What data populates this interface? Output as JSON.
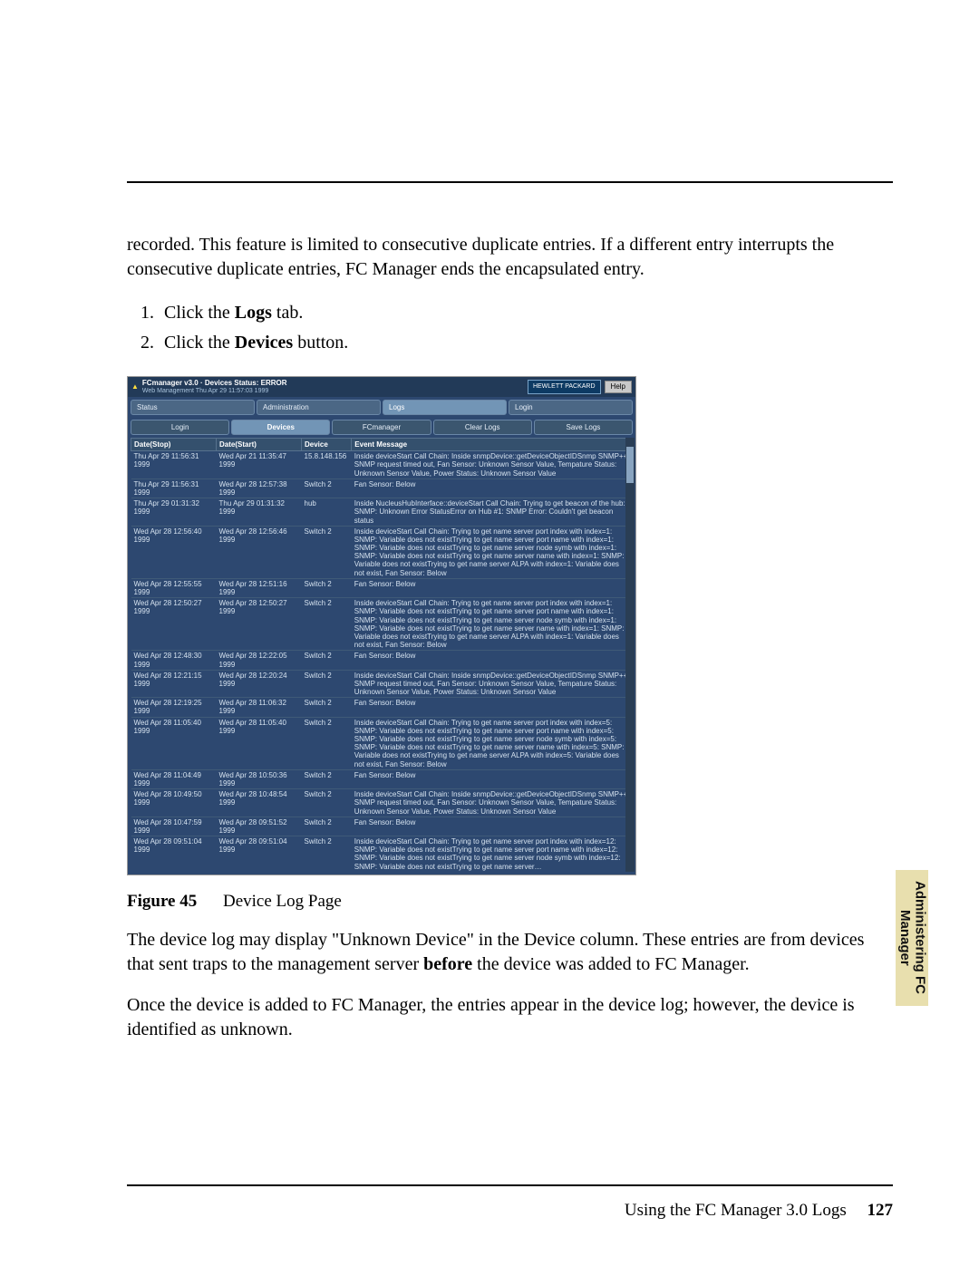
{
  "paragraphs": {
    "intro": "recorded. This feature is limited to consecutive duplicate entries. If a different entry interrupts the consecutive duplicate entries, FC Manager ends the encapsulated entry.",
    "after_fig_1a": "The device log may display \"Unknown Device\" in the Device column. These entries are from devices that sent traps to the management server ",
    "after_fig_1_bold": "before",
    "after_fig_1b": " the device was added to FC Manager.",
    "after_fig_2": "Once the device is added to FC Manager, the entries appear in the device log; however, the device is identified as unknown."
  },
  "steps": {
    "s1a": "Click the ",
    "s1bold": "Logs",
    "s1b": " tab.",
    "s2a": "Click the ",
    "s2bold": "Devices",
    "s2b": " button."
  },
  "figure": {
    "label": "Figure 45",
    "caption": "Device Log Page"
  },
  "screenshot": {
    "title_line1": "FCmanager v3.0 · Devices Status: ERROR",
    "title_line2": "Web Management Thu Apr 29 11:57:03 1999",
    "hp": "HEWLETT PACKARD",
    "help": "Help",
    "top_tabs": [
      "Status",
      "Administration",
      "Logs",
      "Login"
    ],
    "top_tabs_active_index": 2,
    "sub_tabs": [
      "Login",
      "Devices",
      "FCmanager",
      "Clear Logs",
      "Save Logs"
    ],
    "sub_tabs_active_index": 1,
    "columns": [
      "Date(Stop)",
      "Date(Start)",
      "Device",
      "Event Message"
    ],
    "rows": [
      {
        "stop": "Thu Apr 29 11:56:31 1999",
        "start": "Wed Apr 21 11:35:47 1999",
        "device": "15.8.148.156",
        "msg": "Inside deviceStart Call Chain: Inside snmpDevice::getDeviceObjectIDSnmp SNMP++: SNMP request timed out, Fan Sensor: Unknown Sensor Value, Tempature Status: Unknown Sensor Value, Power Status: Unknown Sensor Value"
      },
      {
        "stop": "Thu Apr 29 11:56:31 1999",
        "start": "Wed Apr 28 12:57:38 1999",
        "device": "Switch 2",
        "msg": "Fan Sensor: Below"
      },
      {
        "stop": "Thu Apr 29 01:31:32 1999",
        "start": "Thu Apr 29 01:31:32 1999",
        "device": "hub",
        "msg": "Inside NucleusHubInterface::deviceStart Call Chain: Trying to get beacon of the hub: SNMP: Unknown Error StatusError on Hub #1: SNMP Error: Couldn't get beacon status"
      },
      {
        "stop": "Wed Apr 28 12:56:40 1999",
        "start": "Wed Apr 28 12:56:46 1999",
        "device": "Switch 2",
        "msg": "Inside deviceStart Call Chain: Trying to get name server port index with index=1: SNMP: Variable does not existTrying to get name server port name with index=1: SNMP: Variable does not existTrying to get name server node symb with index=1: SNMP: Variable does not existTrying to get name server name with index=1: SNMP: Variable does not existTrying to get name server ALPA with index=1: Variable does not exist, Fan Sensor: Below"
      },
      {
        "stop": "Wed Apr 28 12:55:55 1999",
        "start": "Wed Apr 28 12:51:16 1999",
        "device": "Switch 2",
        "msg": "Fan Sensor: Below"
      },
      {
        "stop": "Wed Apr 28 12:50:27 1999",
        "start": "Wed Apr 28 12:50:27 1999",
        "device": "Switch 2",
        "msg": "Inside deviceStart Call Chain: Trying to get name server port index with index=1: SNMP: Variable does not existTrying to get name server port name with index=1: SNMP: Variable does not existTrying to get name server node symb with index=1: SNMP: Variable does not existTrying to get name server name with index=1: SNMP: Variable does not existTrying to get name server ALPA with index=1: Variable does not exist, Fan Sensor: Below"
      },
      {
        "stop": "Wed Apr 28 12:48:30 1999",
        "start": "Wed Apr 28 12:22:05 1999",
        "device": "Switch 2",
        "msg": "Fan Sensor: Below"
      },
      {
        "stop": "Wed Apr 28 12:21:15 1999",
        "start": "Wed Apr 28 12:20:24 1999",
        "device": "Switch 2",
        "msg": "Inside deviceStart Call Chain: Inside snmpDevice::getDeviceObjectIDSnmp SNMP++: SNMP request timed out, Fan Sensor: Unknown Sensor Value, Tempature Status: Unknown Sensor Value, Power Status: Unknown Sensor Value"
      },
      {
        "stop": "Wed Apr 28 12:19:25 1999",
        "start": "Wed Apr 28 11:06:32 1999",
        "device": "Switch 2",
        "msg": "Fan Sensor: Below"
      },
      {
        "stop": "Wed Apr 28 11:05:40 1999",
        "start": "Wed Apr 28 11:05:40 1999",
        "device": "Switch 2",
        "msg": "Inside deviceStart Call Chain: Trying to get name server port index with index=5: SNMP: Variable does not existTrying to get name server port name with index=5: SNMP: Variable does not existTrying to get name server node symb with index=5: SNMP: Variable does not existTrying to get name server name with index=5: SNMP: Variable does not existTrying to get name server ALPA with index=5: Variable does not exist, Fan Sensor: Below"
      },
      {
        "stop": "Wed Apr 28 11:04:49 1999",
        "start": "Wed Apr 28 10:50:36 1999",
        "device": "Switch 2",
        "msg": "Fan Sensor: Below"
      },
      {
        "stop": "Wed Apr 28 10:49:50 1999",
        "start": "Wed Apr 28 10:48:54 1999",
        "device": "Switch 2",
        "msg": "Inside deviceStart Call Chain: Inside snmpDevice::getDeviceObjectIDSnmp SNMP++: SNMP request timed out, Fan Sensor: Unknown Sensor Value, Tempature Status: Unknown Sensor Value, Power Status: Unknown Sensor Value"
      },
      {
        "stop": "Wed Apr 28 10:47:59 1999",
        "start": "Wed Apr 28 09:51:52 1999",
        "device": "Switch 2",
        "msg": "Fan Sensor: Below"
      },
      {
        "stop": "Wed Apr 28 09:51:04 1999",
        "start": "Wed Apr 28 09:51:04 1999",
        "device": "Switch 2",
        "msg": "Inside deviceStart Call Chain: Trying to get name server port index with index=12: SNMP: Variable does not existTrying to get name server port name with index=12: SNMP: Variable does not existTrying to get name server node symb with index=12: SNMP: Variable does not existTrying to get name server…"
      }
    ]
  },
  "side_tab": "Administering FC Manager",
  "footer": {
    "text": "Using the FC Manager 3.0 Logs",
    "page": "127"
  }
}
